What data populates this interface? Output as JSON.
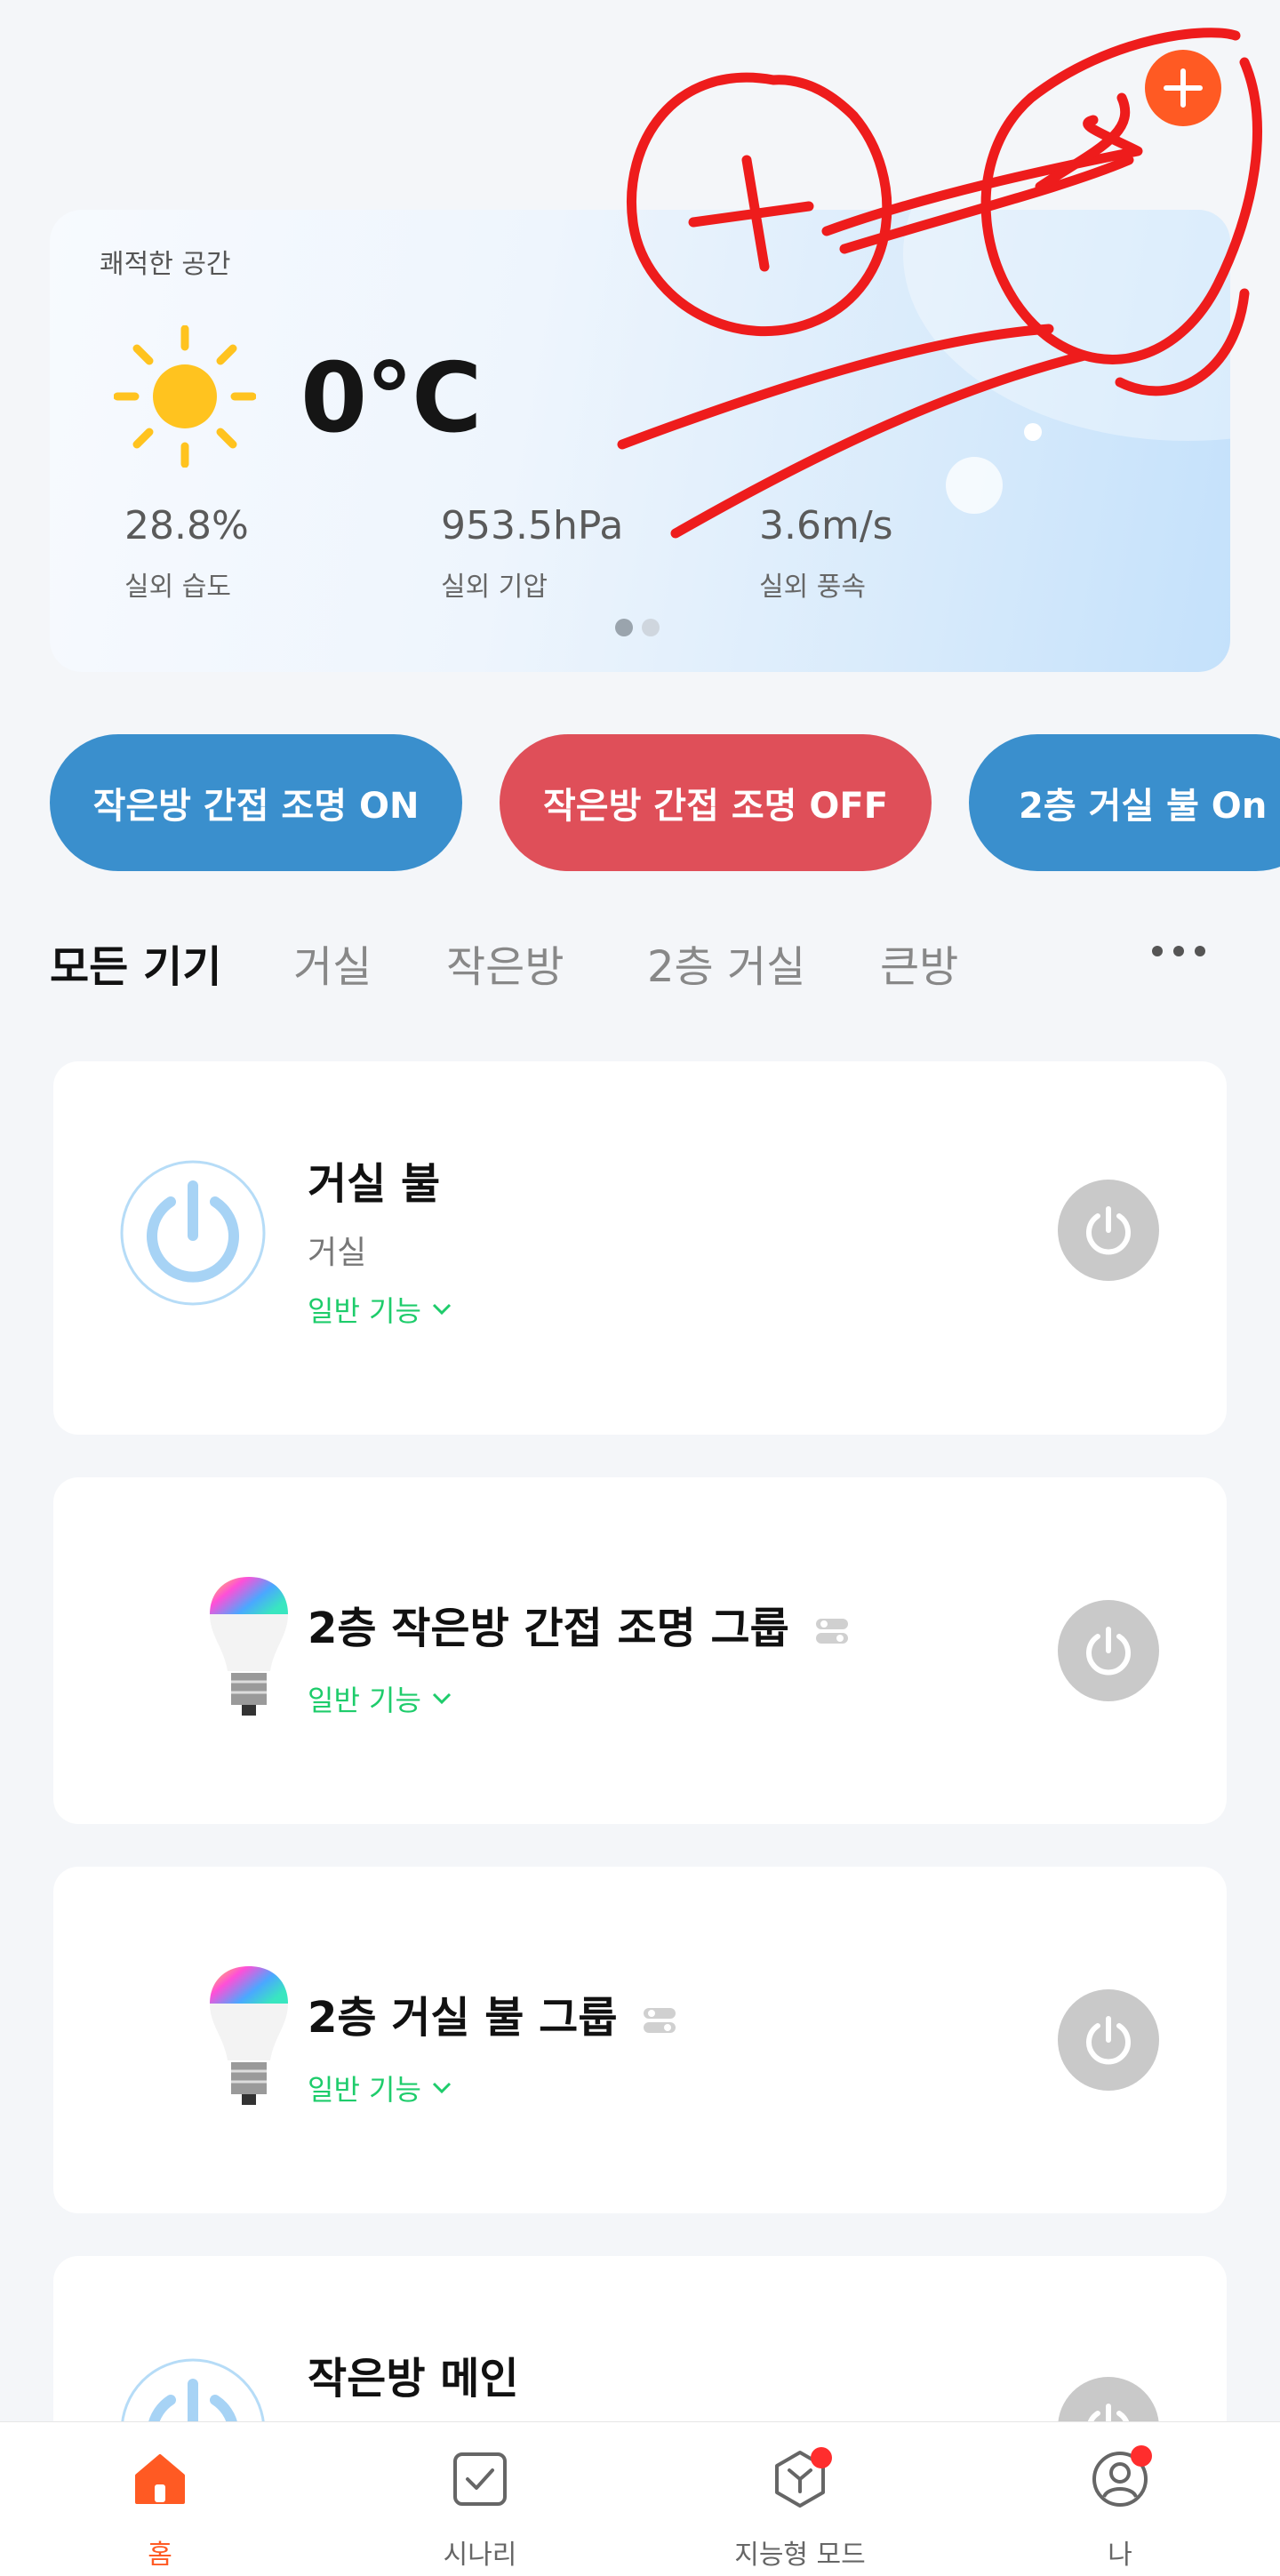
{
  "header": {
    "add_icon": "plus-icon",
    "accent": "#ff5a23"
  },
  "weather": {
    "title": "쾌적한 공간",
    "icon": "sun-icon",
    "temperature": "0°C",
    "stats": [
      {
        "value": "28.8%",
        "label": "실외 습도"
      },
      {
        "value": "953.5hPa",
        "label": "실외 기압"
      },
      {
        "value": "3.6m/s",
        "label": "실외 풍속"
      }
    ],
    "page_count": 2,
    "active_page": 1
  },
  "scenes": [
    {
      "label": "작은방 간접 조명 ON",
      "color": "#3a8fcd"
    },
    {
      "label": "작은방 간접 조명 OFF",
      "color": "#df4f59"
    },
    {
      "label": "2층 거실 불 On",
      "color": "#3a8fcd"
    }
  ],
  "rooms": {
    "tabs": [
      "모든 기기",
      "거실",
      "작은방",
      "2층 거실",
      "큰방"
    ],
    "active": "모든 기기",
    "more_icon": "more-horizontal-icon"
  },
  "devices": [
    {
      "name": "거실 불",
      "room": "거실",
      "function": "일반 기능",
      "icon": "power-device-icon",
      "group": false
    },
    {
      "name": "2층 작은방 간접 조명 그룹",
      "room": "",
      "function": "일반 기능",
      "icon": "rgb-bulb-icon",
      "group": true
    },
    {
      "name": "2층 거실 불 그룹",
      "room": "",
      "function": "일반 기능",
      "icon": "rgb-bulb-icon",
      "group": true
    },
    {
      "name": "작은방 메인",
      "room": "",
      "function": "",
      "icon": "power-device-icon",
      "group": false
    }
  ],
  "nav": {
    "items": [
      {
        "label": "홈",
        "icon": "home-icon",
        "active": true,
        "badge": false
      },
      {
        "label": "시나리",
        "icon": "scenario-check-icon",
        "active": false,
        "badge": false
      },
      {
        "label": "지능형 모드",
        "icon": "smart-mode-icon",
        "active": false,
        "badge": true
      },
      {
        "label": "나",
        "icon": "profile-icon",
        "active": false,
        "badge": true
      }
    ]
  },
  "colors": {
    "on_green": "#1ecc6b",
    "power_off": "#c9c9c9",
    "badge": "#ff2d2d",
    "annotation": "#ee1c1c"
  }
}
